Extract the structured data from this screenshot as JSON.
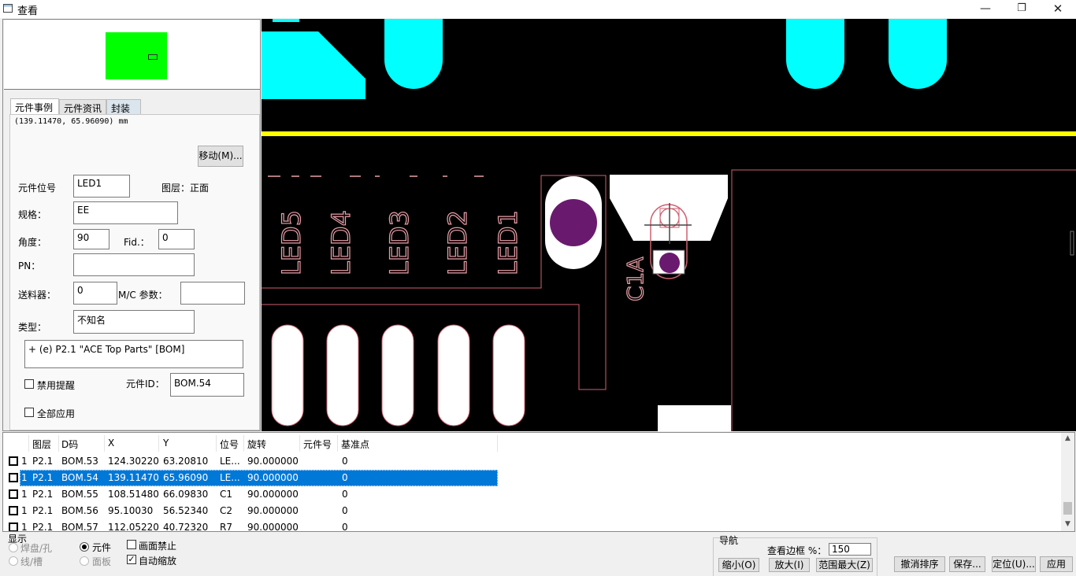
{
  "window": {
    "title": "查看",
    "minimize_glyph": "—",
    "maximize_glyph": "❐",
    "close_glyph": "✕"
  },
  "left_panel": {
    "tabs": [
      "元件事例",
      "元件资讯",
      "封装"
    ],
    "coordinates": "(139.11470, 65.96090) mm",
    "move_button": "移动(M)...",
    "labels": {
      "ref": "元件位号",
      "layer": "图层：正面",
      "spec": "规格：",
      "angle": "角度：",
      "fid": "Fid.：",
      "pn": "PN：",
      "feeder": "送料器：",
      "mc_param": "M/C 参数：",
      "type": "类型：",
      "disable_alert": "禁用提醒",
      "component_id": "元件ID：",
      "apply_all": "全部应用"
    },
    "values": {
      "ref": "LED1",
      "spec": "EE",
      "angle": "90",
      "fid": "0",
      "pn": "",
      "feeder": "0",
      "mc_param": "",
      "type": "不知名",
      "bom_info": "+ (e) P2.1 \"ACE Top Parts\" [BOM]",
      "component_id": "BOM.54"
    },
    "checkboxes": {
      "disable_alert": false,
      "apply_all": false
    }
  },
  "pcb": {
    "silkscreen": [
      "LED5",
      "LED4",
      "LED3",
      "LED2",
      "LED1",
      "C1A"
    ],
    "colors": {
      "background": "#000000",
      "copper": "#00ffff",
      "trace": "#ffff00",
      "outline": "#d06070",
      "via": "#6a1a6e",
      "pad": "#ffffff",
      "silk": "#e9a0a8"
    }
  },
  "table": {
    "headers": [
      "图层",
      "D码",
      "X",
      "Y",
      "位号",
      "旋转",
      "元件号",
      "基准点"
    ],
    "rows": [
      {
        "n": "1",
        "layer": "P2.1",
        "dcode": "BOM.53",
        "x": "124.30220",
        "y": "63.20810",
        "ref": "LE...",
        "rot": "90.000000",
        "part": "",
        "fid": "0",
        "selected": false
      },
      {
        "n": "1",
        "layer": "P2.1",
        "dcode": "BOM.54",
        "x": "139.11470",
        "y": "65.96090",
        "ref": "LE...",
        "rot": "90.000000",
        "part": "",
        "fid": "0",
        "selected": true
      },
      {
        "n": "1",
        "layer": "P2.1",
        "dcode": "BOM.55",
        "x": "108.51480",
        "y": "66.09830",
        "ref": "C1",
        "rot": "90.000000",
        "part": "",
        "fid": "0",
        "selected": false
      },
      {
        "n": "1",
        "layer": "P2.1",
        "dcode": "BOM.56",
        "x": "95.10030",
        "y": "56.52340",
        "ref": "C2",
        "rot": "90.000000",
        "part": "",
        "fid": "0",
        "selected": false
      },
      {
        "n": "1",
        "layer": "P2.1",
        "dcode": "BOM.57",
        "x": "112.05220",
        "y": "40.72320",
        "ref": "R7",
        "rot": "90.000000",
        "part": "",
        "fid": "0",
        "selected": false
      }
    ]
  },
  "bottom": {
    "display_group": "显示",
    "radio_pad": "焊盘/孔",
    "radio_part": "元件",
    "radio_line": "线/槽",
    "radio_panel": "面板",
    "check_no_draw": "画面禁止",
    "check_auto_zoom": "自动缩放",
    "nav_group": "导航",
    "view_margin_label": "查看边框 %：",
    "view_margin_value": "150",
    "zoom_out": "缩小(O)",
    "zoom_in": "放大(I)",
    "zoom_extent": "范围最大(Z)",
    "undo_sort": "撤消排序",
    "save": "保存...",
    "locate": "定位(U)...",
    "apply": "应用"
  }
}
